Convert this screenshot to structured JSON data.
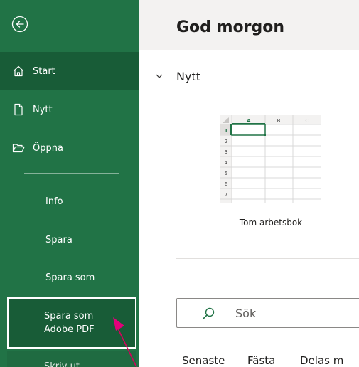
{
  "sidebar": {
    "back_icon": "back-arrow-circle-icon",
    "items": [
      {
        "label": "Start",
        "icon": "home-icon"
      },
      {
        "label": "Nytt",
        "icon": "new-document-icon"
      },
      {
        "label": "Öppna",
        "icon": "folder-open-icon"
      },
      {
        "label": "Info"
      },
      {
        "label": "Spara"
      },
      {
        "label": "Spara som"
      }
    ],
    "pdf_item": {
      "line1": "Spara som",
      "line2": "Adobe PDF"
    },
    "partial_item": "Skriv ut",
    "colors": {
      "bg": "#217346",
      "active": "#185c37"
    }
  },
  "main": {
    "greeting": "God morgon",
    "section": "Nytt",
    "template": {
      "caption": "Tom arbetsbok",
      "columns": [
        "A",
        "B",
        "C"
      ],
      "rows": [
        "1",
        "2",
        "3",
        "4",
        "5",
        "6",
        "7"
      ]
    },
    "search": {
      "placeholder": "Sök"
    },
    "tabs": [
      "Senaste",
      "Fästa",
      "Delas m"
    ]
  }
}
